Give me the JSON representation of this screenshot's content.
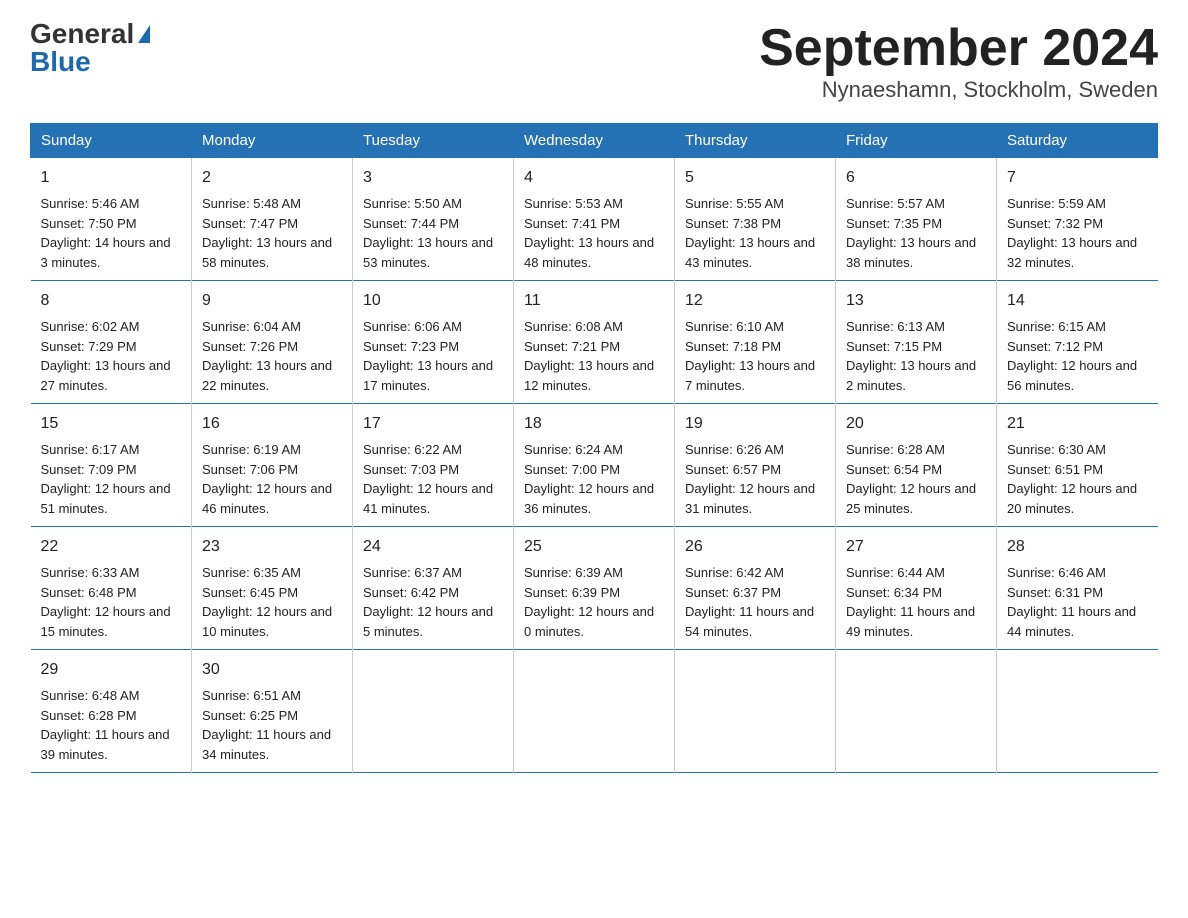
{
  "logo": {
    "general": "General",
    "blue": "Blue"
  },
  "title": "September 2024",
  "subtitle": "Nynaeshamn, Stockholm, Sweden",
  "days_of_week": [
    "Sunday",
    "Monday",
    "Tuesday",
    "Wednesday",
    "Thursday",
    "Friday",
    "Saturday"
  ],
  "weeks": [
    [
      {
        "day": "1",
        "sunrise": "5:46 AM",
        "sunset": "7:50 PM",
        "daylight": "14 hours and 3 minutes."
      },
      {
        "day": "2",
        "sunrise": "5:48 AM",
        "sunset": "7:47 PM",
        "daylight": "13 hours and 58 minutes."
      },
      {
        "day": "3",
        "sunrise": "5:50 AM",
        "sunset": "7:44 PM",
        "daylight": "13 hours and 53 minutes."
      },
      {
        "day": "4",
        "sunrise": "5:53 AM",
        "sunset": "7:41 PM",
        "daylight": "13 hours and 48 minutes."
      },
      {
        "day": "5",
        "sunrise": "5:55 AM",
        "sunset": "7:38 PM",
        "daylight": "13 hours and 43 minutes."
      },
      {
        "day": "6",
        "sunrise": "5:57 AM",
        "sunset": "7:35 PM",
        "daylight": "13 hours and 38 minutes."
      },
      {
        "day": "7",
        "sunrise": "5:59 AM",
        "sunset": "7:32 PM",
        "daylight": "13 hours and 32 minutes."
      }
    ],
    [
      {
        "day": "8",
        "sunrise": "6:02 AM",
        "sunset": "7:29 PM",
        "daylight": "13 hours and 27 minutes."
      },
      {
        "day": "9",
        "sunrise": "6:04 AM",
        "sunset": "7:26 PM",
        "daylight": "13 hours and 22 minutes."
      },
      {
        "day": "10",
        "sunrise": "6:06 AM",
        "sunset": "7:23 PM",
        "daylight": "13 hours and 17 minutes."
      },
      {
        "day": "11",
        "sunrise": "6:08 AM",
        "sunset": "7:21 PM",
        "daylight": "13 hours and 12 minutes."
      },
      {
        "day": "12",
        "sunrise": "6:10 AM",
        "sunset": "7:18 PM",
        "daylight": "13 hours and 7 minutes."
      },
      {
        "day": "13",
        "sunrise": "6:13 AM",
        "sunset": "7:15 PM",
        "daylight": "13 hours and 2 minutes."
      },
      {
        "day": "14",
        "sunrise": "6:15 AM",
        "sunset": "7:12 PM",
        "daylight": "12 hours and 56 minutes."
      }
    ],
    [
      {
        "day": "15",
        "sunrise": "6:17 AM",
        "sunset": "7:09 PM",
        "daylight": "12 hours and 51 minutes."
      },
      {
        "day": "16",
        "sunrise": "6:19 AM",
        "sunset": "7:06 PM",
        "daylight": "12 hours and 46 minutes."
      },
      {
        "day": "17",
        "sunrise": "6:22 AM",
        "sunset": "7:03 PM",
        "daylight": "12 hours and 41 minutes."
      },
      {
        "day": "18",
        "sunrise": "6:24 AM",
        "sunset": "7:00 PM",
        "daylight": "12 hours and 36 minutes."
      },
      {
        "day": "19",
        "sunrise": "6:26 AM",
        "sunset": "6:57 PM",
        "daylight": "12 hours and 31 minutes."
      },
      {
        "day": "20",
        "sunrise": "6:28 AM",
        "sunset": "6:54 PM",
        "daylight": "12 hours and 25 minutes."
      },
      {
        "day": "21",
        "sunrise": "6:30 AM",
        "sunset": "6:51 PM",
        "daylight": "12 hours and 20 minutes."
      }
    ],
    [
      {
        "day": "22",
        "sunrise": "6:33 AM",
        "sunset": "6:48 PM",
        "daylight": "12 hours and 15 minutes."
      },
      {
        "day": "23",
        "sunrise": "6:35 AM",
        "sunset": "6:45 PM",
        "daylight": "12 hours and 10 minutes."
      },
      {
        "day": "24",
        "sunrise": "6:37 AM",
        "sunset": "6:42 PM",
        "daylight": "12 hours and 5 minutes."
      },
      {
        "day": "25",
        "sunrise": "6:39 AM",
        "sunset": "6:39 PM",
        "daylight": "12 hours and 0 minutes."
      },
      {
        "day": "26",
        "sunrise": "6:42 AM",
        "sunset": "6:37 PM",
        "daylight": "11 hours and 54 minutes."
      },
      {
        "day": "27",
        "sunrise": "6:44 AM",
        "sunset": "6:34 PM",
        "daylight": "11 hours and 49 minutes."
      },
      {
        "day": "28",
        "sunrise": "6:46 AM",
        "sunset": "6:31 PM",
        "daylight": "11 hours and 44 minutes."
      }
    ],
    [
      {
        "day": "29",
        "sunrise": "6:48 AM",
        "sunset": "6:28 PM",
        "daylight": "11 hours and 39 minutes."
      },
      {
        "day": "30",
        "sunrise": "6:51 AM",
        "sunset": "6:25 PM",
        "daylight": "11 hours and 34 minutes."
      },
      null,
      null,
      null,
      null,
      null
    ]
  ],
  "labels": {
    "sunrise_prefix": "Sunrise: ",
    "sunset_prefix": "Sunset: ",
    "daylight_prefix": "Daylight: "
  }
}
